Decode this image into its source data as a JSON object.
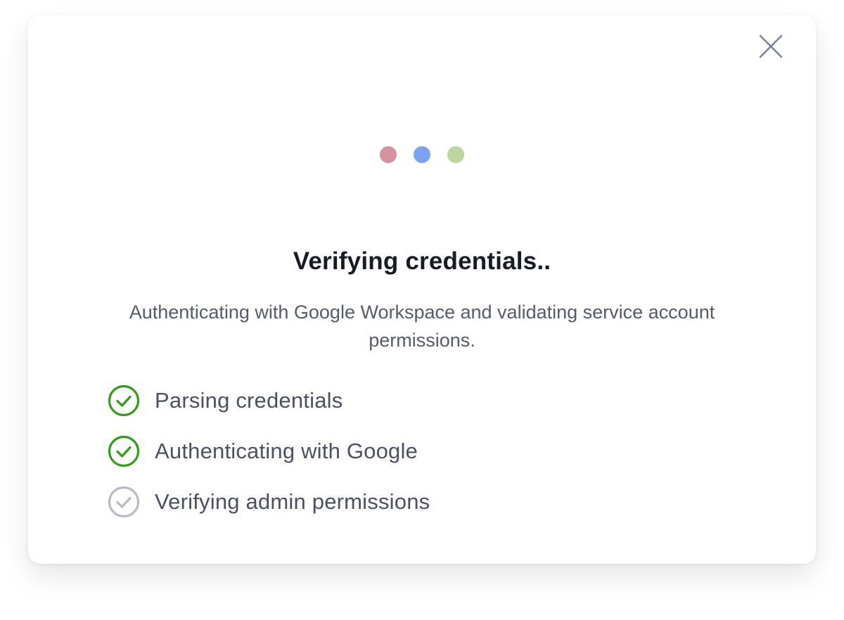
{
  "dialog": {
    "close_icon": "close-icon",
    "loader_dots": [
      {
        "color": "#d9919f"
      },
      {
        "color": "#7aa3ef"
      },
      {
        "color": "#bcd79d"
      }
    ],
    "title": "Verifying credentials..",
    "subtitle": "Authenticating with Google Workspace and validating service account permissions."
  },
  "steps": [
    {
      "label": "Parsing credentials",
      "status": "complete",
      "icon": "check-circle-icon",
      "color": "#2e9e14"
    },
    {
      "label": "Authenticating with Google",
      "status": "complete",
      "icon": "check-circle-icon",
      "color": "#2e9e14"
    },
    {
      "label": "Verifying admin permissions",
      "status": "pending",
      "icon": "check-circle-icon",
      "color": "#b6bcc6"
    }
  ],
  "colors": {
    "title": "#161b26",
    "text": "#4b5163",
    "close": "#7a8494"
  }
}
